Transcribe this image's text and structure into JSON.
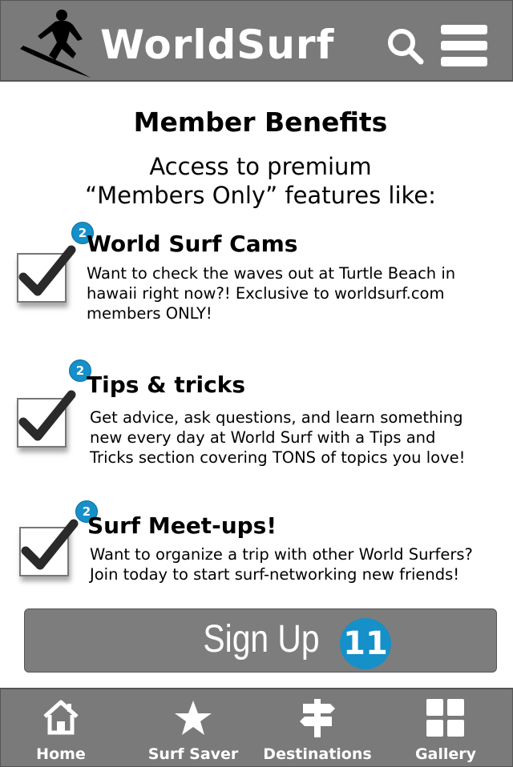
{
  "header": {
    "brand": "WorldSurf",
    "logo_icon": "surfer-icon",
    "search_icon": "search-icon",
    "menu_icon": "hamburger-menu-icon"
  },
  "main": {
    "title": "Member Benefits",
    "intro_line1": "Access to premium",
    "intro_line2": "“Members Only” features like:",
    "features": [
      {
        "badge": "2",
        "title": "World Surf Cams",
        "desc_lines": [
          "Want to check the waves out at Turtle Beach in",
          "hawaii right now?! Exclusive to worldsurf.com",
          "members ONLY!"
        ]
      },
      {
        "badge": "2",
        "title": "Tips & tricks",
        "desc_lines": [
          "Get advice, ask questions, and learn something",
          "new every day at World Surf with a Tips and",
          "Tricks section covering TONS of topics you love!"
        ]
      },
      {
        "badge": "2",
        "title": "Surf Meet-ups!",
        "desc_lines": [
          "Want to organize a trip with other World Surfers?",
          "Join today to start surf-networking new friends!"
        ]
      }
    ],
    "signup_label": "Sign Up",
    "signup_badge": "11"
  },
  "nav": {
    "items": [
      {
        "label": "Home",
        "icon": "home-icon"
      },
      {
        "label": "Surf Saver",
        "icon": "star-icon"
      },
      {
        "label": "Destinations",
        "icon": "signpost-icon"
      },
      {
        "label": "Gallery",
        "icon": "grid-icon"
      }
    ]
  },
  "colors": {
    "bar_gray": "#7a7a7a",
    "badge_blue": "#1590c8",
    "text": "#000000"
  }
}
